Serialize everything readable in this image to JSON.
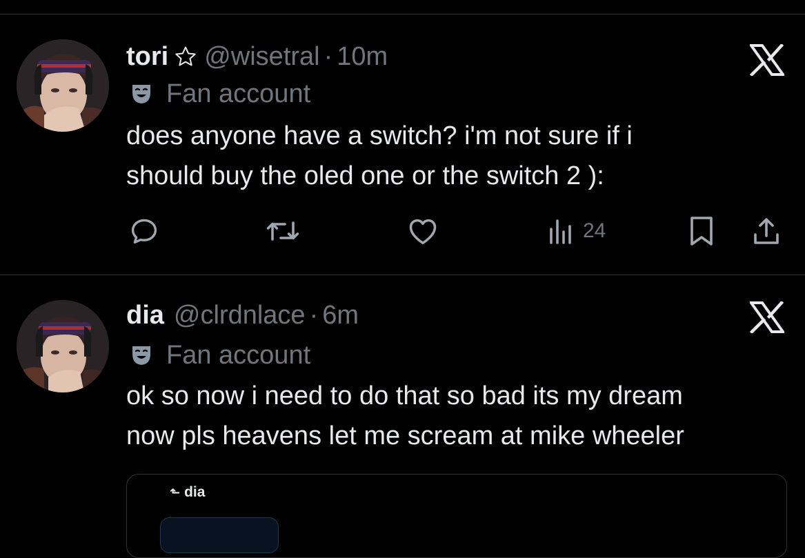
{
  "tweets": [
    {
      "name": "tori",
      "star_icon": "star-outline-icon",
      "handle": "@wisetral",
      "separator": "·",
      "time": "10m",
      "label_icon": "theater-mask-icon",
      "label": "Fan account",
      "text_lines": [
        "does anyone have a switch? i'm not sure if i",
        "should buy the oled one or the switch 2 ):"
      ],
      "actions": {
        "reply_icon": "reply-icon",
        "retweet_icon": "retweet-icon",
        "like_icon": "heart-icon",
        "views_icon": "views-icon",
        "views_count": "24",
        "bookmark_icon": "bookmark-icon",
        "share_icon": "share-icon"
      }
    },
    {
      "name": "dia",
      "handle": "@clrdnlace",
      "separator": "·",
      "time": "6m",
      "label_icon": "theater-mask-icon",
      "label": "Fan account",
      "text_lines": [
        "ok so now i need to do that so bad its my dream",
        "now pls heavens let me scream at mike wheeler"
      ],
      "quote": {
        "reply_icon": "reply-arrow-icon",
        "name": "dia"
      }
    }
  ],
  "colors": {
    "background": "#000000",
    "text": "#e7e9ea",
    "secondary_text": "#71767b",
    "divider": "#2f3336"
  }
}
